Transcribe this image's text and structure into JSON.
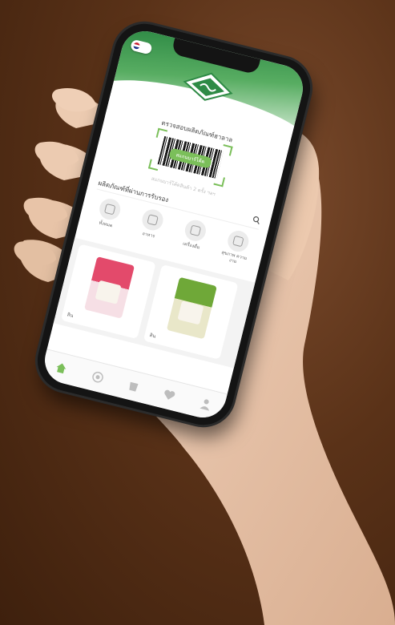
{
  "app": {
    "scan_title": "ตรวจสอบผลิตภัณฑ์ฮาลาล",
    "scan_button": "สแกนบาร์โค้ด",
    "scan_sub": "สแกนบาร์โค้ดสินค้า 2 ครั้ง ฯลฯ",
    "search_title": "ผลิตภัณฑ์ที่ผ่านการรับรอง",
    "categories": [
      {
        "label": "ทั้งหมด",
        "icon": "grid-icon"
      },
      {
        "label": "อาหาร",
        "icon": "food-icon"
      },
      {
        "label": "เครื่องดื่ม",
        "icon": "bottle-icon"
      },
      {
        "label": "สุขภาพ ความงาม",
        "icon": "cosmetic-icon"
      }
    ],
    "products": [
      {
        "label": "สิน",
        "pack_color": "#e34a6b"
      },
      {
        "label": "สิน",
        "pack_color": "#6fa838"
      }
    ],
    "tabs": [
      {
        "icon": "home-icon",
        "color": "#7bbf5a"
      },
      {
        "icon": "scan-icon",
        "color": "#bdbdbd"
      },
      {
        "icon": "cup-icon",
        "color": "#bdbdbd"
      },
      {
        "icon": "heart-icon",
        "color": "#bdbdbd"
      },
      {
        "icon": "user-icon",
        "color": "#bdbdbd"
      }
    ]
  },
  "colors": {
    "brand_green": "#2e8a45",
    "accent_green": "#7bbf5a",
    "background_brown": "#5a3218",
    "skin": "#e8c4a8"
  }
}
